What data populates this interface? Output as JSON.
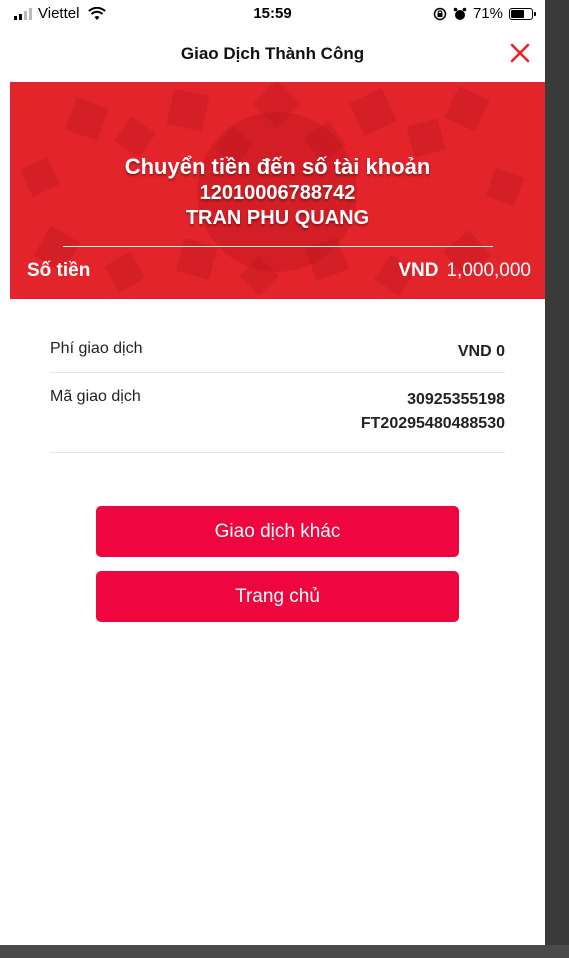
{
  "status_bar": {
    "carrier": "Viettel",
    "time": "15:59",
    "battery": "71%",
    "battery_level": 0.71
  },
  "nav": {
    "title": "Giao Dịch Thành Công",
    "close_icon": "close-icon",
    "accent_color": "#e3242b"
  },
  "banner": {
    "line1": "Chuyển tiền đến số tài khoản",
    "account_number": "12010006788742",
    "recipient_name": "TRAN PHU QUANG",
    "amount_label": "Số tiền",
    "currency": "VND",
    "amount": "1,000,000",
    "background_color": "#e3242b"
  },
  "details": {
    "fee_label": "Phí giao dịch",
    "fee_value": "VND 0",
    "txn_label": "Mã giao dịch",
    "txn_value_1": "30925355198",
    "txn_value_2": "FT20295480488530"
  },
  "buttons": {
    "other_txn": "Giao dịch khác",
    "home": "Trang chủ",
    "color": "#f0063f"
  }
}
